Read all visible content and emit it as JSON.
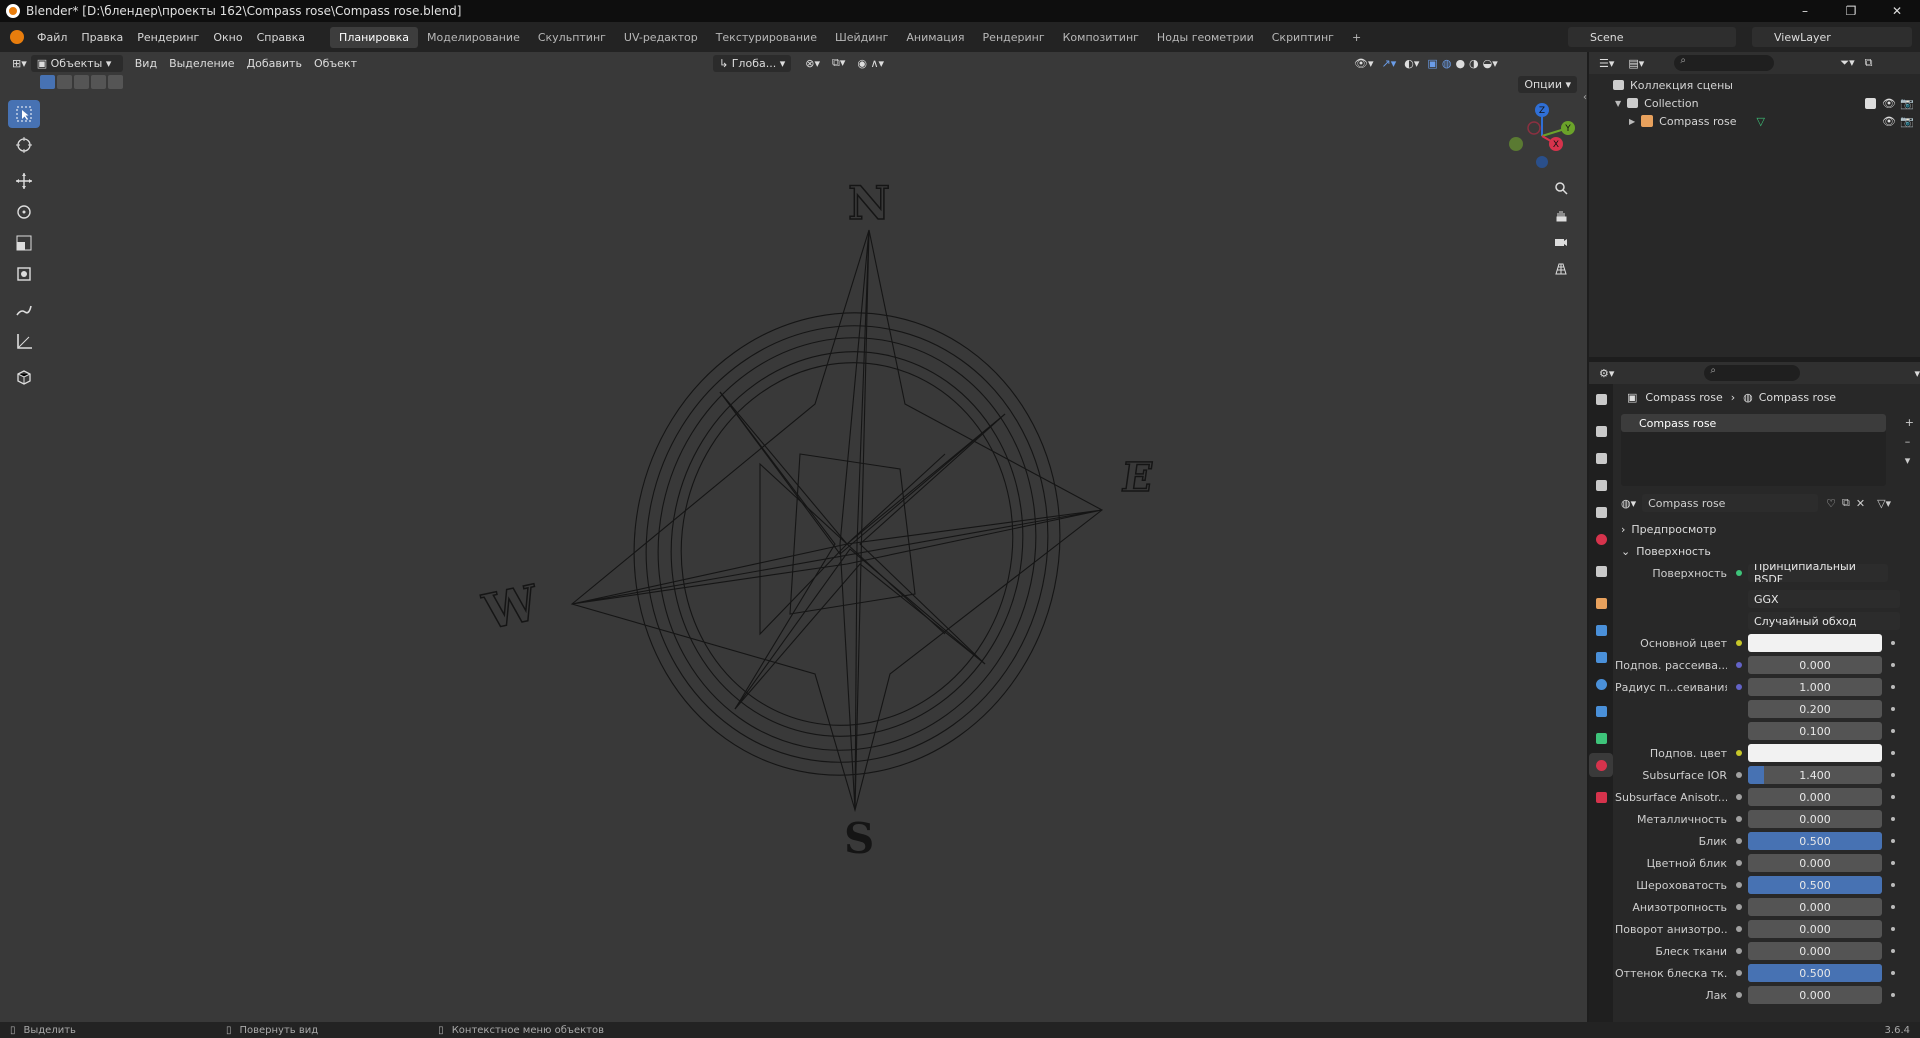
{
  "window": {
    "title": "Blender* [D:\\блендер\\проекты 162\\Compass rose\\Compass rose.blend]",
    "controls": [
      "–",
      "❐",
      "✕"
    ]
  },
  "menu": {
    "items": [
      "Файл",
      "Правка",
      "Рендеринг",
      "Окно",
      "Справка"
    ],
    "workspaces": [
      "Планировка",
      "Моделирование",
      "Скульптинг",
      "UV-редактор",
      "Текстурирование",
      "Шейдинг",
      "Анимация",
      "Рендеринг",
      "Композитинг",
      "Ноды геометрии",
      "Скриптинг",
      "+"
    ],
    "active_workspace": "Планировка",
    "scene": "Scene",
    "view_layer": "ViewLayer"
  },
  "viewport": {
    "mode": "Объекты",
    "menu": [
      "Вид",
      "Выделение",
      "Добавить",
      "Объект"
    ],
    "orientation": "Глоба...",
    "options": "Опции",
    "compass_letters": [
      "N",
      "E",
      "S",
      "W"
    ],
    "gizmo_axes": [
      "Z",
      "Y",
      "X"
    ]
  },
  "outliner": {
    "rows": [
      {
        "label": "Коллекция сцены",
        "indent": 0
      },
      {
        "label": "Collection",
        "indent": 1
      },
      {
        "label": "Compass rose",
        "indent": 2
      }
    ]
  },
  "properties": {
    "breadcrumb": [
      "Compass rose",
      "Compass rose"
    ],
    "slot": "Compass rose",
    "material_name": "Compass rose",
    "panels": [
      "Предпросмотр",
      "Поверхность"
    ],
    "surface": {
      "label": "Поверхность",
      "value": "Принципиальный BSDF"
    },
    "distribution": "GGX",
    "sss_method": "Случайный обход",
    "rows": [
      {
        "label": "Основной цвет",
        "value": "",
        "type": "color",
        "sock": "#c7c729"
      },
      {
        "label": "Подпов. рассеива...",
        "value": "0.000",
        "fill": 0,
        "sock": "#6363c7"
      },
      {
        "label": "Радиус п...сеивания",
        "value": "1.000",
        "fill": 0,
        "sock": "#6363c7"
      },
      {
        "label": "",
        "value": "0.200",
        "fill": 0,
        "sock": ""
      },
      {
        "label": "",
        "value": "0.100",
        "fill": 0,
        "sock": ""
      },
      {
        "label": "Подпов. цвет",
        "value": "",
        "type": "color",
        "sock": "#c7c729"
      },
      {
        "label": "Subsurface IOR",
        "value": "1.400",
        "fill": 0.12,
        "sock": "#a1a1a1"
      },
      {
        "label": "Subsurface Anisotr...",
        "value": "0.000",
        "fill": 0,
        "sock": "#a1a1a1"
      },
      {
        "label": "Металличность",
        "value": "0.000",
        "fill": 0,
        "sock": "#a1a1a1"
      },
      {
        "label": "Блик",
        "value": "0.500",
        "fill": 1,
        "sock": "#a1a1a1"
      },
      {
        "label": "Цветной блик",
        "value": "0.000",
        "fill": 0,
        "sock": "#a1a1a1"
      },
      {
        "label": "Шероховатость",
        "value": "0.500",
        "fill": 1,
        "sock": "#a1a1a1"
      },
      {
        "label": "Анизотропность",
        "value": "0.000",
        "fill": 0,
        "sock": "#a1a1a1"
      },
      {
        "label": "Поворот анизотро...",
        "value": "0.000",
        "fill": 0,
        "sock": "#a1a1a1"
      },
      {
        "label": "Блеск ткани",
        "value": "0.000",
        "fill": 0,
        "sock": "#a1a1a1"
      },
      {
        "label": "Оттенок блеска тк...",
        "value": "0.500",
        "fill": 1,
        "sock": "#a1a1a1"
      },
      {
        "label": "Лак",
        "value": "0.000",
        "fill": 0,
        "sock": "#a1a1a1"
      }
    ]
  },
  "status": {
    "items": [
      "Выделить",
      "Повернуть вид",
      "Контекстное меню объектов"
    ],
    "version": "3.6.4"
  },
  "colors": {
    "accent": "#4772b3",
    "selected": "#4772b3"
  }
}
